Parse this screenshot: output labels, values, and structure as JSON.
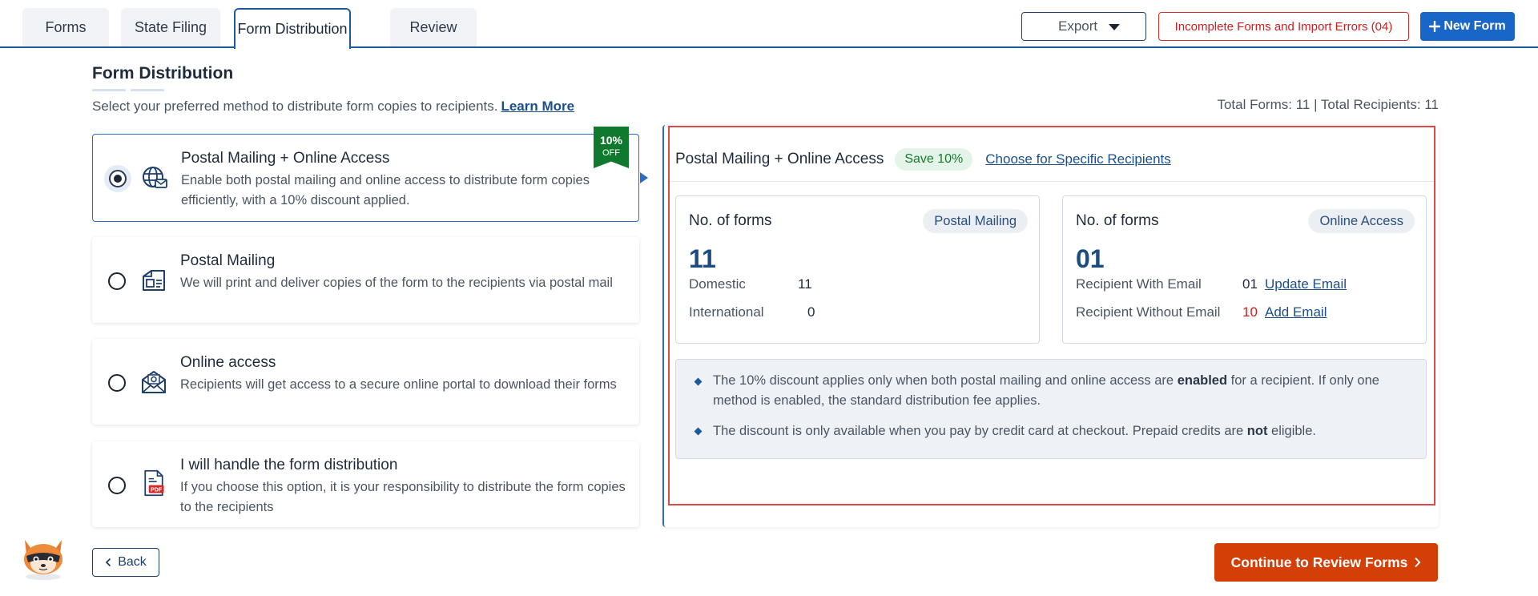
{
  "tabs": [
    {
      "label": "Forms",
      "active": false
    },
    {
      "label": "State Filing",
      "active": false
    },
    {
      "label": "Form Distribution",
      "active": true
    },
    {
      "label": "Review",
      "active": false
    }
  ],
  "toolbar": {
    "export_label": "Export",
    "incomplete_label": "Incomplete Forms and Import Errors (04)",
    "new_form_label": "New Form",
    "new_form_icon": "plus-icon"
  },
  "header": {
    "title": "Form Distribution",
    "subtitle": "Select your preferred method to distribute form copies to recipients.",
    "learn_more": "Learn More",
    "totals": "Total Forms: 11 | Total Recipients: 11"
  },
  "options": [
    {
      "title": "Postal Mailing + Online Access",
      "description": "Enable both postal mailing and online access to distribute form copies efficiently, with a 10% discount applied.",
      "icon": "globe-mail-icon",
      "selected": true,
      "ribbon_top": "10%",
      "ribbon_bottom": "OFF"
    },
    {
      "title": "Postal Mailing",
      "description": "We will print and deliver copies of the form to the recipients via postal mail",
      "icon": "mailbox-icon",
      "selected": false
    },
    {
      "title": "Online access",
      "description": "Recipients will get access to a secure online portal to download their forms",
      "icon": "email-at-icon",
      "selected": false
    },
    {
      "title": "I will handle the form distribution",
      "description": "If you choose this option, it is your responsibility to distribute the form copies to the recipients",
      "icon": "pdf-file-icon",
      "selected": false,
      "icon_text": "PDF"
    }
  ],
  "panel": {
    "title": "Postal Mailing + Online Access",
    "save_badge": "Save 10%",
    "specific_link": "Choose for Specific Recipients",
    "postal": {
      "label": "No. of forms",
      "pill": "Postal Mailing",
      "count": "11",
      "rows": [
        {
          "label": "Domestic",
          "value": "11"
        },
        {
          "label": "International",
          "value": "0"
        }
      ]
    },
    "online": {
      "label": "No. of forms",
      "pill": "Online Access",
      "count": "01",
      "rows": [
        {
          "label": "Recipient With Email",
          "value": "01",
          "link": "Update Email"
        },
        {
          "label": "Recipient Without Email",
          "value": "10",
          "link": "Add Email"
        }
      ]
    },
    "notes": [
      {
        "pre": "The 10% discount applies only when both postal mailing and online access are ",
        "bold": "enabled",
        "post": " for a recipient. If only one method is enabled, the standard distribution fee applies."
      },
      {
        "pre": "The discount is only available when you pay by credit card at checkout. Prepaid credits are ",
        "bold": "not",
        "post": " eligible."
      }
    ]
  },
  "footer": {
    "back_label": "Back",
    "continue_label": "Continue to Review Forms"
  },
  "colors": {
    "primary": "#1d5a9c",
    "accent_orange": "#d33f06",
    "error_red": "#cc1f1f",
    "success_green": "#0f7a2e"
  }
}
